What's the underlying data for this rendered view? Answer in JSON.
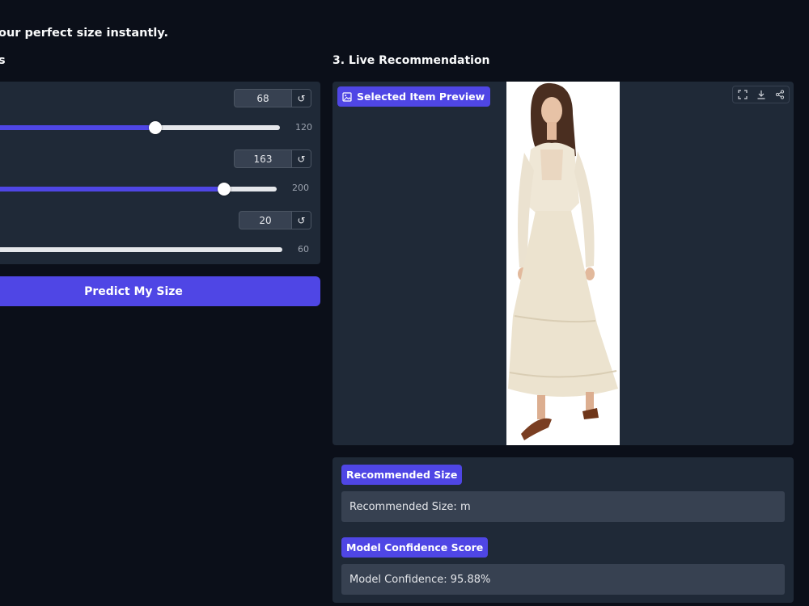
{
  "header": {
    "subtitle": "our perfect size instantly.",
    "left_section": "s",
    "right_section": "3. Live Recommendation"
  },
  "sliders": [
    {
      "value": 68,
      "min": 0,
      "max": 120,
      "max_label": "120",
      "reset_icon": "↺"
    },
    {
      "value": 163,
      "min": 0,
      "max": 200,
      "max_label": "200",
      "reset_icon": "↺"
    },
    {
      "value": 20,
      "min": 20,
      "max": 60,
      "max_label": "60",
      "reset_icon": "↺"
    }
  ],
  "predict_button": {
    "label": "Predict My Size"
  },
  "preview": {
    "label": "Selected Item Preview",
    "icons": [
      "image-icon",
      "fullscreen-icon",
      "download-icon",
      "share-icon"
    ]
  },
  "results": {
    "size_label": "Recommended Size",
    "size_value": "Recommended Size: m",
    "confidence_label": "Model Confidence Score",
    "confidence_value": "Model Confidence: 95.88%"
  },
  "colors": {
    "background": "#0b0f19",
    "panel": "#1f2937",
    "accent": "#4f46e5",
    "field": "#374151"
  }
}
